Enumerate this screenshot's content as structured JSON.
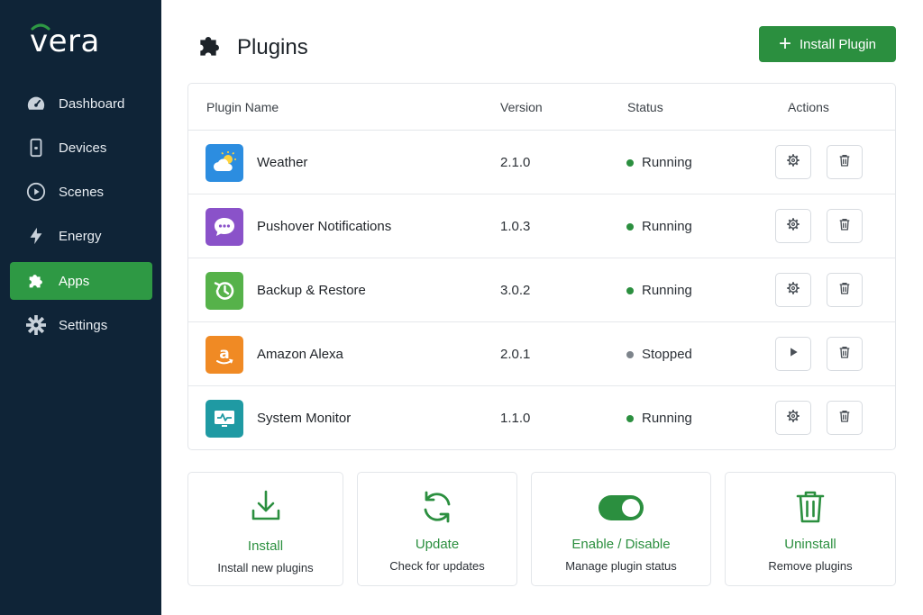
{
  "brand": {
    "name": "vera"
  },
  "sidebar": {
    "items": [
      {
        "label": "Dashboard",
        "icon": "speedometer-icon"
      },
      {
        "label": "Devices",
        "icon": "phone-icon"
      },
      {
        "label": "Scenes",
        "icon": "play-circle-icon"
      },
      {
        "label": "Energy",
        "icon": "lightning-icon"
      },
      {
        "label": "Apps",
        "icon": "puzzle-icon",
        "active": true
      },
      {
        "label": "Settings",
        "icon": "gear-icon"
      }
    ]
  },
  "header": {
    "title": "Plugins",
    "install_label": "Install Plugin"
  },
  "table": {
    "columns": {
      "name": "Plugin Name",
      "version": "Version",
      "status": "Status",
      "actions": "Actions"
    },
    "rows": [
      {
        "name": "Weather",
        "version": "2.1.0",
        "status": "Running",
        "icon": "weather-icon",
        "primary_action": "settings"
      },
      {
        "name": "Pushover Notifications",
        "version": "1.0.3",
        "status": "Running",
        "icon": "chat-bubble-icon",
        "primary_action": "settings"
      },
      {
        "name": "Backup & Restore",
        "version": "3.0.2",
        "status": "Running",
        "icon": "history-icon",
        "primary_action": "settings"
      },
      {
        "name": "Amazon Alexa",
        "version": "2.0.1",
        "status": "Stopped",
        "icon": "amazon-icon",
        "primary_action": "start"
      },
      {
        "name": "System Monitor",
        "version": "1.1.0",
        "status": "Running",
        "icon": "monitor-pulse-icon",
        "primary_action": "settings"
      }
    ]
  },
  "cards": [
    {
      "title": "Install",
      "subtitle": "Install new plugins",
      "icon": "download-icon"
    },
    {
      "title": "Update",
      "subtitle": "Check for updates",
      "icon": "refresh-icon"
    },
    {
      "title": "Enable / Disable",
      "subtitle": "Manage plugin status",
      "icon": "toggle-icon"
    },
    {
      "title": "Uninstall",
      "subtitle": "Remove plugins",
      "icon": "trash-icon"
    }
  ],
  "colors": {
    "sidebar_bg": "#0f2437",
    "accent": "#2b8f3f",
    "active_nav": "#2e9944",
    "running": "#2b8f3f",
    "stopped": "#7d848b"
  }
}
